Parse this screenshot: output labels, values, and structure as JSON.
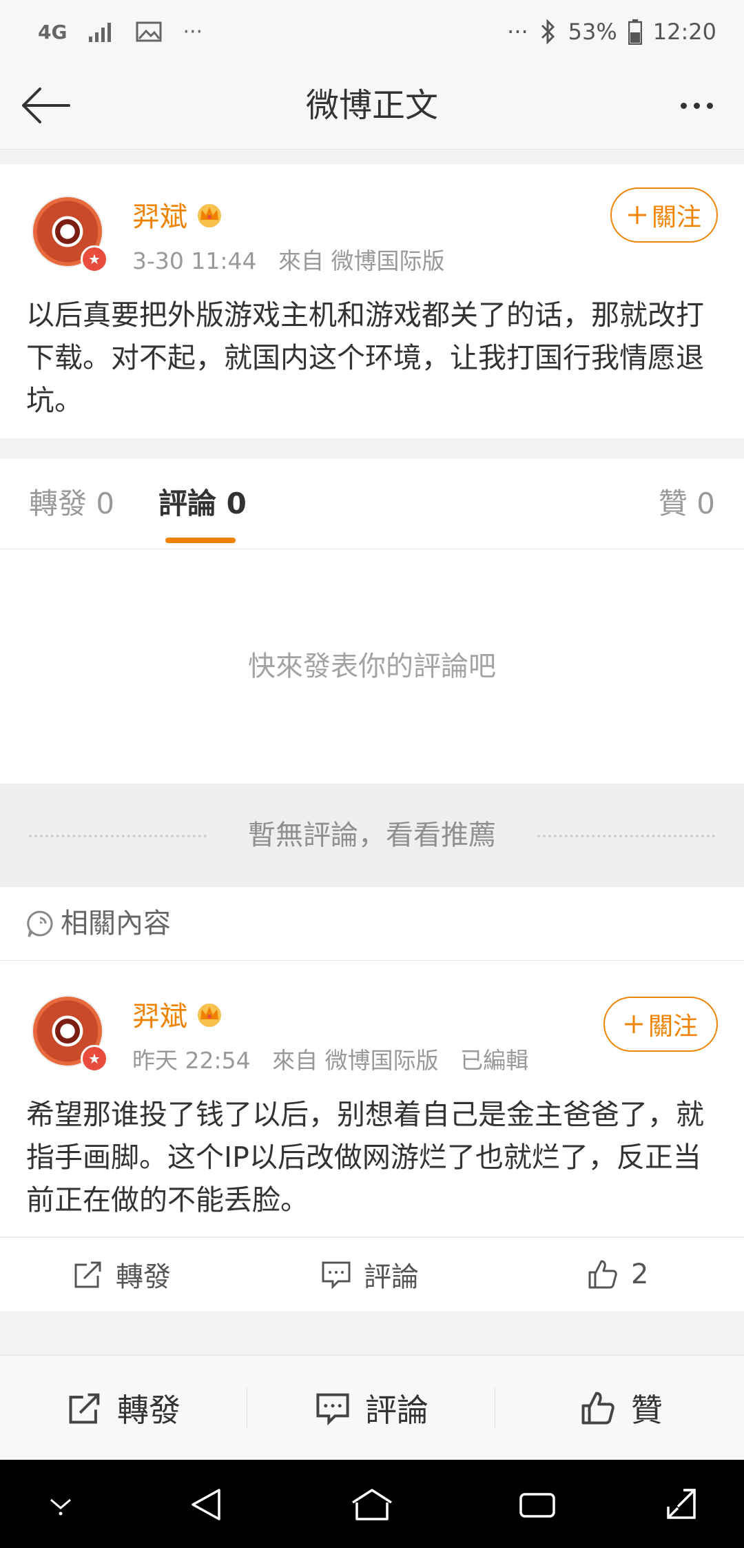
{
  "status_bar": {
    "network": "4G",
    "more": "···",
    "more_right": "···",
    "battery": "53%",
    "time": "12:20"
  },
  "header": {
    "title": "微博正文"
  },
  "post": {
    "username": "羿斌",
    "time": "3-30 11:44",
    "source": "來自 微博国际版",
    "follow_label": "關注",
    "text": "以后真要把外版游戏主机和游戏都关了的话，那就改打下载。对不起，就国内这个环境，让我打国行我情愿退坑。"
  },
  "tabs": {
    "repost": "轉發 0",
    "comment": "評論 0",
    "like": "贊 0"
  },
  "comments_empty": "快來發表你的評論吧",
  "recommend_label": "暫無評論，看看推薦",
  "related_label": "相關內容",
  "related_post": {
    "username": "羿斌",
    "time": "昨天 22:54",
    "source": "來自 微博国际版",
    "edited": "已編輯",
    "follow_label": "關注",
    "text": "希望那谁投了钱了以后，别想着自己是金主爸爸了，就指手画脚。这个IP以后改做网游烂了也就烂了，反正当前正在做的不能丢脸。",
    "repost_label": "轉發",
    "comment_label": "評論",
    "like_count": "2"
  },
  "bottom_bar": {
    "repost_label": "轉發",
    "comment_label": "評論",
    "like_label": "贊"
  },
  "colors": {
    "accent": "#f08200",
    "username": "#f08200",
    "verified_badge": "#e94b3c"
  }
}
